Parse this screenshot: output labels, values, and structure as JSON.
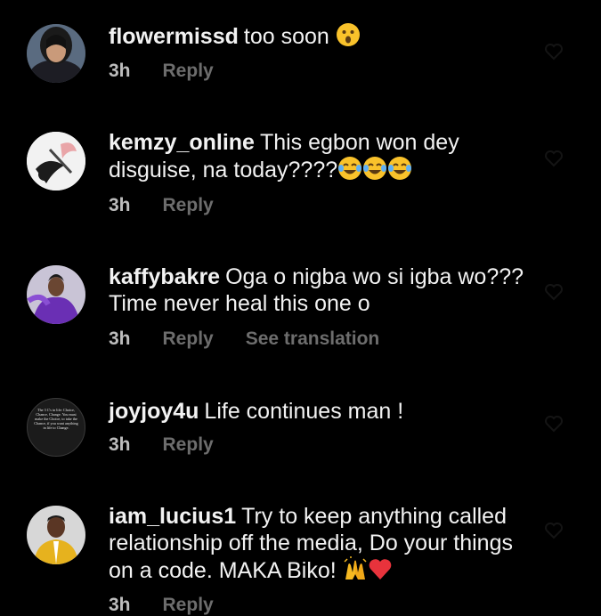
{
  "comments": [
    {
      "username": "flowermissd",
      "text": "too soon",
      "emojis": [
        "astonished-face-emoji"
      ],
      "time": "3h",
      "reply": "Reply",
      "avatar": "woman-portrait-avatar"
    },
    {
      "username": "kemzy_online",
      "text": "This egbon won dey disguise, na today????",
      "emojis": [
        "tears-of-joy-emoji",
        "tears-of-joy-emoji",
        "tears-of-joy-emoji"
      ],
      "time": "3h",
      "reply": "Reply",
      "avatar": "illustrated-figure-avatar"
    },
    {
      "username": "kaffybakre",
      "text": "Oga o nigba wo si igba wo??? Time never heal this one o",
      "emojis": [],
      "time": "3h",
      "reply": "Reply",
      "see_translation": "See translation",
      "avatar": "purple-outfit-avatar"
    },
    {
      "username": "joyjoy4u",
      "text": "Life continues man !",
      "emojis": [],
      "time": "3h",
      "reply": "Reply",
      "avatar": "quote-text-avatar",
      "avatar_text": "The 3 C's in life: Choice, Chance, Change. You must make the Choice, to take the Chance, if you want anything in life to Change."
    },
    {
      "username": "iam_lucius1",
      "text": "Try to keep anything called relationship off the media, Do your things on a code. MAKA Biko!",
      "emojis": [
        "raising-hands-emoji",
        "red-heart-emoji"
      ],
      "time": "3h",
      "reply": "Reply",
      "avatar": "yellow-suit-avatar"
    }
  ],
  "colors": {
    "background": "#000000",
    "text": "#f2f2f2",
    "meta_time": "#bdbdbd",
    "meta_action": "#6d6d6d"
  }
}
